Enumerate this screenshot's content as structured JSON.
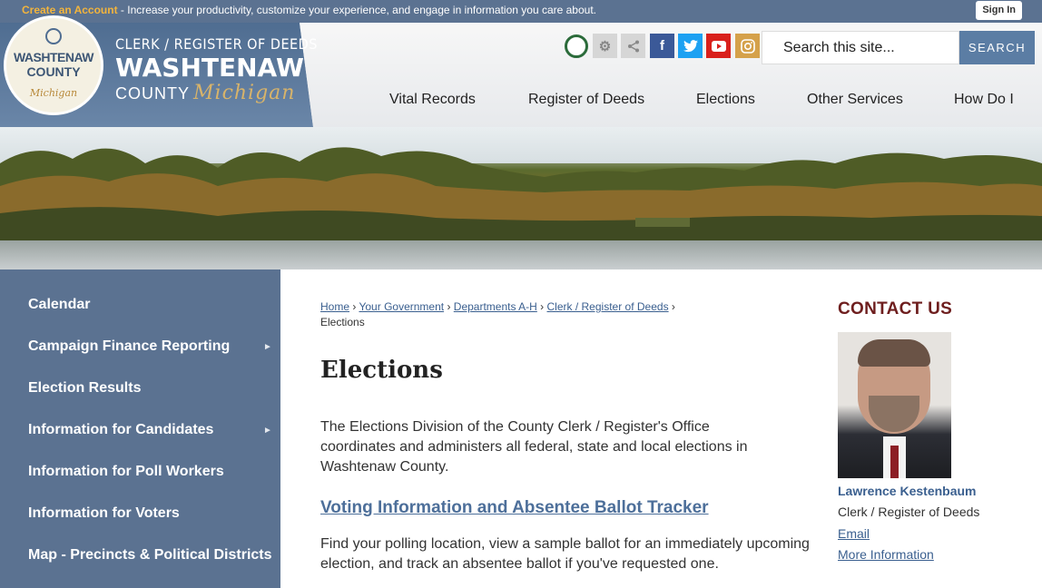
{
  "topbar": {
    "create_label": "Create an Account",
    "message": " - Increase your productivity, customize your experience, and engage in information you care about.",
    "signin_label": "Sign In"
  },
  "seal": {
    "line1": "WASHTENAW",
    "line2": "COUNTY",
    "line3": "Michigan"
  },
  "brand": {
    "line1": "CLERK / REGISTER OF DEEDS",
    "line2": "WASHTENAW",
    "line3": "COUNTY",
    "line3_script": "Michigan"
  },
  "social_icons": [
    "county-seal-icon",
    "gear-icon",
    "share-icon",
    "facebook-icon",
    "twitter-icon",
    "youtube-icon",
    "instagram-icon"
  ],
  "search": {
    "placeholder": "Search this site...",
    "button_label": "SEARCH"
  },
  "nav": [
    "Vital Records",
    "Register of Deeds",
    "Elections",
    "Other Services",
    "How Do I"
  ],
  "sidebar": {
    "items": [
      {
        "label": "Calendar",
        "has_submenu": false
      },
      {
        "label": "Campaign Finance Reporting",
        "has_submenu": true
      },
      {
        "label": "Election Results",
        "has_submenu": false
      },
      {
        "label": "Information for Candidates",
        "has_submenu": true
      },
      {
        "label": "Information for Poll Workers",
        "has_submenu": false
      },
      {
        "label": "Information for Voters",
        "has_submenu": false
      },
      {
        "label": "Map - Precincts & Political Districts",
        "has_submenu": false
      }
    ],
    "arrow_glyph": "►"
  },
  "breadcrumb": {
    "items": [
      "Home",
      "Your Government",
      "Departments A-H",
      "Clerk / Register of Deeds"
    ],
    "current": "Elections",
    "separator": "›"
  },
  "main": {
    "title": "Elections",
    "intro": "The Elections Division of the County Clerk / Register's Office coordinates and administers all federal, state and local elections in Washtenaw County.",
    "sublink": "Voting Information and Absentee Ballot Tracker",
    "subtext": "Find your polling location, view a sample ballot for an immediately upcoming election, and track an absentee ballot if you've requested one."
  },
  "contact": {
    "heading": "CONTACT US",
    "name": "Lawrence Kestenbaum",
    "role": "Clerk / Register of Deeds",
    "email_label": "Email",
    "more_label": "More Information"
  },
  "colors": {
    "topbar": "#5b7291",
    "sidebar": "#5b7291",
    "accent_gold": "#f2b43d",
    "link": "#3a5f8f",
    "contact_heading": "#6e1e1e"
  }
}
